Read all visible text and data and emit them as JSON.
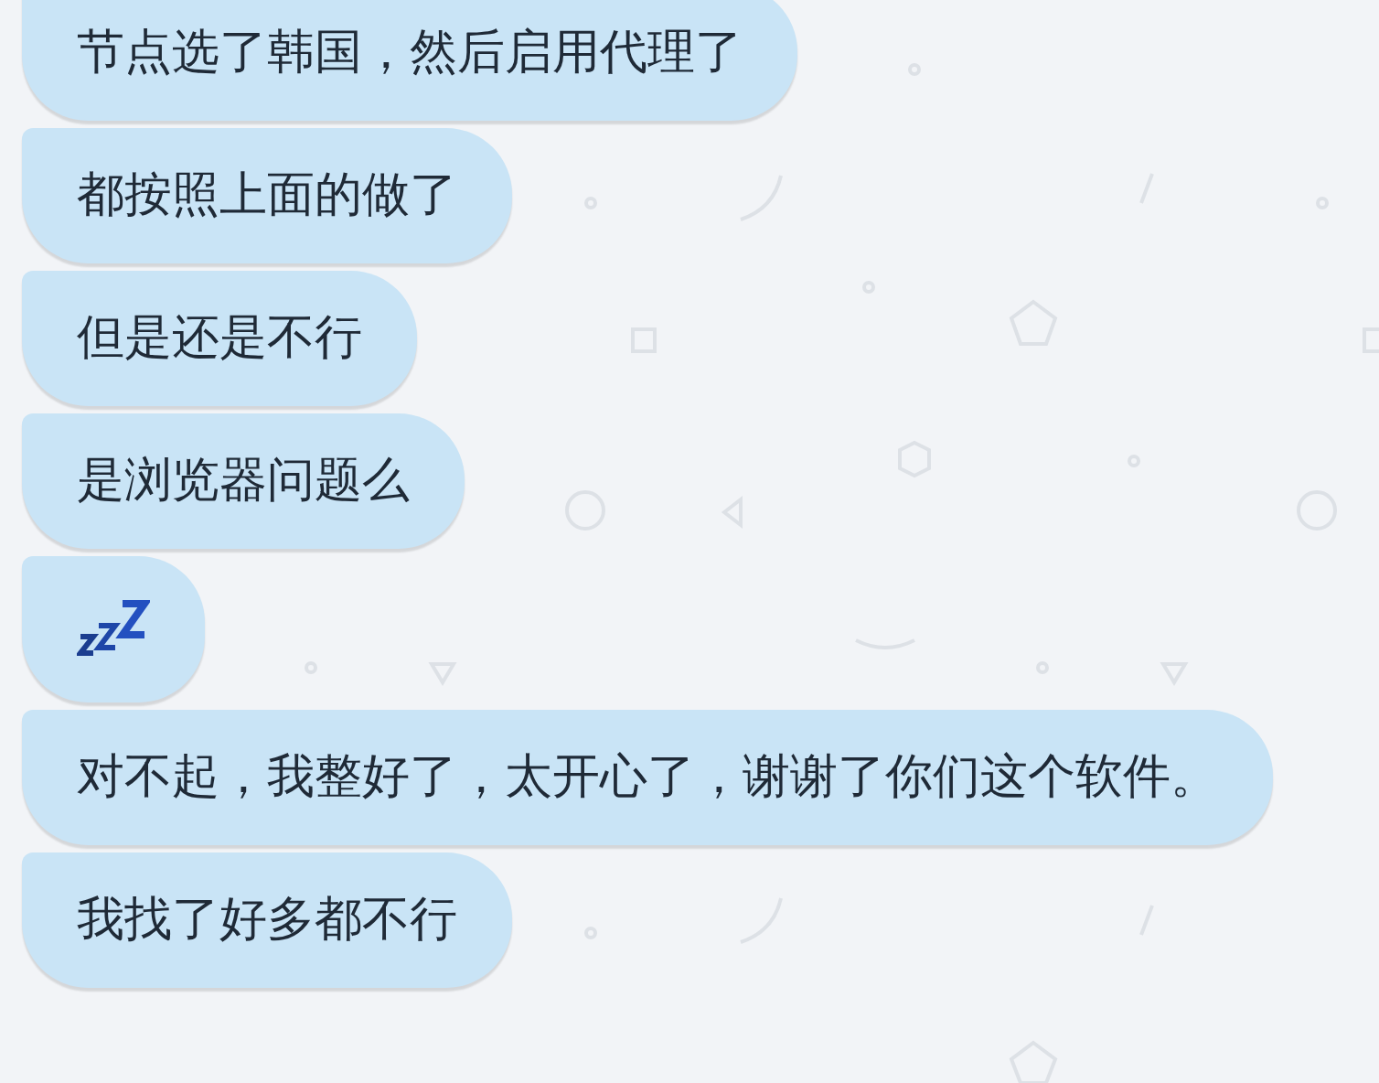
{
  "messages": [
    {
      "kind": "text",
      "text": "节点选了韩国，然后启用代理了"
    },
    {
      "kind": "text",
      "text": "都按照上面的做了"
    },
    {
      "kind": "text",
      "text": "但是还是不行"
    },
    {
      "kind": "text",
      "text": "是浏览器问题么"
    },
    {
      "kind": "sleep_emoji"
    },
    {
      "kind": "text",
      "text": "对不起，我整好了，太开心了，谢谢了你们这个软件。"
    },
    {
      "kind": "text",
      "text": "我找了好多都不行"
    }
  ]
}
